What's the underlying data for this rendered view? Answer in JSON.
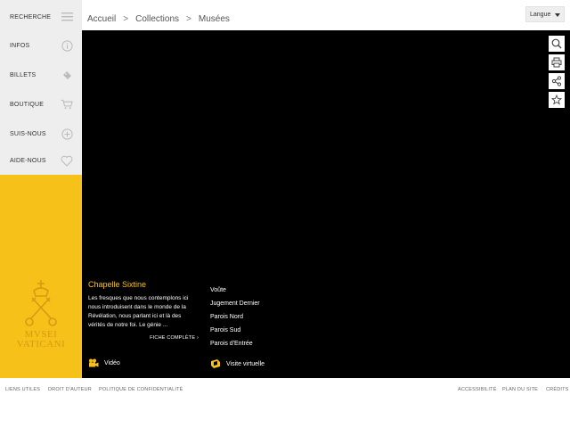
{
  "sidebar": {
    "items": [
      {
        "label": "RECHERCHE",
        "icon": "menu-icon"
      },
      {
        "label": "INFOS",
        "icon": "info-icon"
      },
      {
        "label": "BILLETS",
        "icon": "ticket-icon"
      },
      {
        "label": "BOUTIQUE",
        "icon": "cart-icon"
      },
      {
        "label": "SUIS-NOUS",
        "icon": "plus-circle-icon"
      },
      {
        "label": "AIDE-NOUS",
        "icon": "heart-icon"
      }
    ],
    "brand": {
      "line1": "MVSEI",
      "line2": "VATICANI",
      "accent": "#f6c21a"
    }
  },
  "header": {
    "breadcrumb": [
      "Accueil",
      "Collections",
      "Musées"
    ],
    "separator": ">",
    "language_label": "Langue"
  },
  "toolbar": {
    "icons": [
      "search-icon",
      "print-icon",
      "share-icon",
      "star-icon"
    ]
  },
  "main": {
    "title": "Chapelle Sixtine",
    "description": "Les fresques que nous contemplons ici nous introduisent dans le monde de la Révélation, nous parlant ici et là des vérités de notre foi. Le génie ...",
    "more_label": "FICHE COMPLÈTE",
    "links": [
      "Voûte",
      "Jugement Dernier",
      "Parois Nord",
      "Parois Sud",
      "Parois d'Entrée"
    ],
    "video_label": "Vidéo",
    "virtual_tour_label": "Visite virtuelle"
  },
  "footer": {
    "left": [
      "LIENS UTILES",
      "DROIT D'AUTEUR",
      "POLITIQUE DE CONFIDENTIALITÉ"
    ],
    "right": [
      "ACCESSIBILITÉ",
      "PLAN DU SITE",
      "CRÉDITS"
    ]
  }
}
